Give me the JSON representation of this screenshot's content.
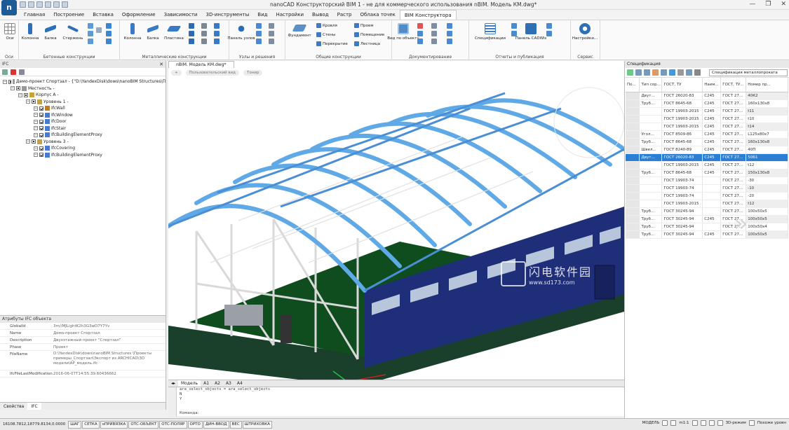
{
  "window": {
    "title": "nanoCAD Конструкторский BIM 1 - не для коммерческого использования nBIM. Модель КМ.dwg*",
    "buttons": [
      "—",
      "❐",
      "✕"
    ]
  },
  "menu": {
    "tabs": [
      "Главная",
      "Построение",
      "Вставка",
      "Оформление",
      "Зависимости",
      "3D-инструменты",
      "Вид",
      "Настройки",
      "Вывод",
      "Растр",
      "Облака точек",
      "BIM Конструктора"
    ],
    "active_index": 11
  },
  "ribbon": {
    "groups": [
      {
        "title": "Оси",
        "buttons": [
          "Оси"
        ]
      },
      {
        "title": "Бетонные конструкции",
        "buttons": [
          "Колонна",
          "Балка",
          "Стержень"
        ]
      },
      {
        "title": "Металлические конструкции",
        "buttons": [
          "Колонна",
          "Балка",
          "Пластина"
        ]
      },
      {
        "title": "Узлы и решения",
        "buttons": [
          "Панель узлов"
        ]
      },
      {
        "title": "Общие конструкции",
        "buttons": [
          "Фундамент",
          "Кровля",
          "Стены",
          "Перекрытие",
          "Проем",
          "Помещение",
          "Лестница"
        ]
      },
      {
        "title": "Документирование",
        "buttons": [
          "Вид по объекту"
        ]
      },
      {
        "title": "Отчеты и публикация",
        "buttons": [
          "Спецификации",
          "Панель CADWis"
        ]
      },
      {
        "title": "Сервис",
        "buttons": [
          "Настройки..."
        ]
      }
    ]
  },
  "left_panel": {
    "header": "IFC",
    "tree": [
      {
        "label": "Демо-проект Спортзал - {\"D:\\YandexDisk\\dows\\nanoBIM Structures\\П",
        "level": 0
      },
      {
        "label": "Местность -",
        "level": 1
      },
      {
        "label": "Корпус А -",
        "level": 2
      },
      {
        "label": "Уровень 1 -",
        "level": 3
      },
      {
        "label": "IfcWall",
        "level": 4
      },
      {
        "label": "IfcWindow",
        "level": 4
      },
      {
        "label": "IfcDoor",
        "level": 4
      },
      {
        "label": "IfcStair",
        "level": 4
      },
      {
        "label": "IfcBuildingElementProxy",
        "level": 4
      },
      {
        "label": "Уровень 3 -",
        "level": 3
      },
      {
        "label": "IfcCovering",
        "level": 4
      },
      {
        "label": "IfcBuildingElementProxy",
        "level": 4
      }
    ],
    "attrs_header": "Атрибуты IFC объекта",
    "attrs": [
      {
        "k": "GlobalId",
        "v": "3m//MJLightK2h3G3wD7Y7Yv"
      },
      {
        "k": "Name",
        "v": "Демо-проект Спортзал"
      },
      {
        "k": "Description",
        "v": "Двухэтажный проект \"Спортзал\""
      },
      {
        "k": "Phase",
        "v": "Проект"
      },
      {
        "k": "FileName",
        "v": "D:\\YandexDisk\\dows\\nanoBIM Structures \\Проекты примеры_Спортзал\\Экспорт из ARCHICAD\\3D модели\\АР_модель.ifc"
      },
      {
        "k": "IfcFileLastModification...",
        "v": "2016-06-07T14:55:39.60436662"
      }
    ],
    "bottom_tabs": [
      "Свойства",
      "IFC"
    ]
  },
  "drawing": {
    "doc_tab": "nBIM. Модель КМ.dwg*",
    "view_labels": [
      "+",
      "Пользовательский вид",
      "Тонир"
    ],
    "sheet_tabs": [
      "Модель",
      "A1",
      "A2",
      "A3",
      "A4"
    ],
    "watermark_title": "闪电软件园",
    "watermark_url": "www.sd173.com"
  },
  "command": {
    "lines": [
      "ara_select_objects = ara_select_objects",
      "N",
      "Y"
    ],
    "side_label": "Команда",
    "prompt": "Команда:"
  },
  "spec": {
    "header": "Спецификация",
    "dropdown": "Спецификация металлопроката",
    "columns": [
      "По...",
      "Тип сор...",
      "ГОСТ, ТУ",
      "Наим...",
      "ГОСТ, ТУ...",
      "Номер пр..."
    ],
    "rows": [
      [
        "",
        "Двут...",
        "ГОСТ 26020-83",
        "С245",
        "ГОСТ 27...",
        "40К2"
      ],
      [
        "",
        "Труб...",
        "ГОСТ 8645-68",
        "С245",
        "ГОСТ 27...",
        "160х130х8"
      ],
      [
        "",
        "",
        "ГОСТ 19903-2015",
        "С245",
        "ГОСТ 27...",
        "t11"
      ],
      [
        "",
        "",
        "ГОСТ 19903-2015",
        "С245",
        "ГОСТ 27...",
        "t10"
      ],
      [
        "",
        "",
        "ГОСТ 19903-2015",
        "С245",
        "ГОСТ 27...",
        "t14"
      ],
      [
        "",
        "Угол...",
        "ГОСТ 8509-86",
        "С245",
        "ГОСТ 27...",
        "L125х80х7"
      ],
      [
        "",
        "Труб...",
        "ГОСТ 8645-68",
        "С245",
        "ГОСТ 27...",
        "160х130х8"
      ],
      [
        "",
        "Швел...",
        "ГОСТ 8240-89",
        "С245",
        "ГОСТ 27...",
        "40П"
      ],
      [
        "",
        "Двут...",
        "ГОСТ 26020-83",
        "С245",
        "ГОСТ 27...",
        "50Б1"
      ],
      [
        "",
        "",
        "ГОСТ 19903-2015",
        "С245",
        "ГОСТ 27...",
        "t12"
      ],
      [
        "",
        "Труб...",
        "ГОСТ 8645-68",
        "С245",
        "ГОСТ 27...",
        "150х130х8"
      ],
      [
        "",
        "",
        "ГОСТ 19903-74",
        "",
        "ГОСТ 27...",
        "-30"
      ],
      [
        "",
        "",
        "ГОСТ 19903-74",
        "",
        "ГОСТ 27...",
        "-10"
      ],
      [
        "",
        "",
        "ГОСТ 19903-74",
        "",
        "ГОСТ 27...",
        "-20"
      ],
      [
        "",
        "",
        "ГОСТ 19903-2015",
        "",
        "ГОСТ 27...",
        "t12"
      ],
      [
        "",
        "Труб...",
        "ГОСТ 30245-94",
        "",
        "ГОСТ 27...",
        "100х50х5"
      ],
      [
        "",
        "Труб...",
        "ГОСТ 30245-94",
        "С245",
        "ГОСТ 27...",
        "100х50х5"
      ],
      [
        "",
        "Труб...",
        "ГОСТ 30245-94",
        "",
        "ГОСТ 27...",
        "100х50х4"
      ],
      [
        "",
        "Труб...",
        "ГОСТ 30245-94",
        "С245",
        "ГОСТ 27...",
        "100х50х5"
      ]
    ],
    "selected_row": 8
  },
  "status": {
    "coords": "16108.7812,18779.8134,0.0000",
    "buttons": [
      "ШАГ",
      "СЕТКА",
      "оПРИВЯЗКА",
      "ОТС-ОБЪЕКТ",
      "ОТС-ПОЛЯР",
      "ОРТО",
      "ДИН-ВВОД",
      "ВЕС",
      "ШТРИХОВКА"
    ],
    "mode": "МОДЕЛЬ",
    "scale": "m1:1",
    "view_mode": "3D-режим",
    "defaults": "Похоже уровн"
  },
  "colors": {
    "accent": "#2a7fd4",
    "wall": "#1f2e78",
    "floor": "#0f4d1e",
    "truss": "#5fa9e6"
  }
}
